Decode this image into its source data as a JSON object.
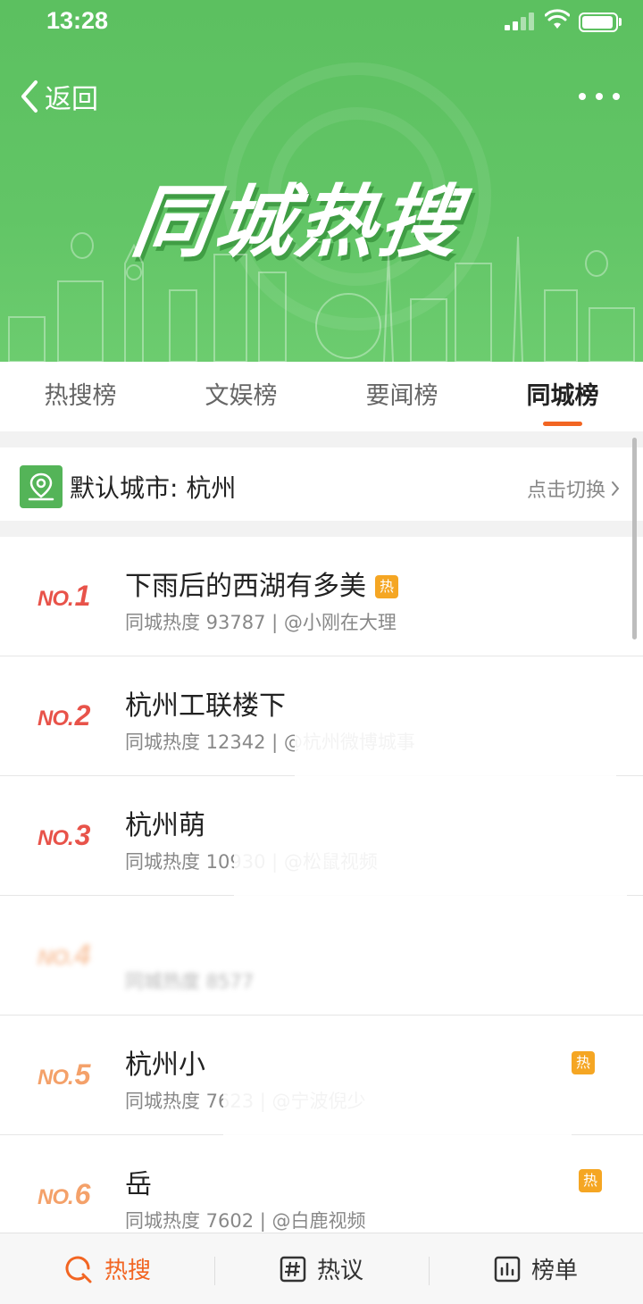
{
  "status_bar": {
    "time": "13:28"
  },
  "nav": {
    "back_label": "返回"
  },
  "banner": {
    "title": "同城热搜"
  },
  "tabs": [
    {
      "label": "热搜榜",
      "active": false
    },
    {
      "label": "文娱榜",
      "active": false
    },
    {
      "label": "要闻榜",
      "active": false
    },
    {
      "label": "同城榜",
      "active": true
    }
  ],
  "city": {
    "label": "默认城市: 杭州",
    "switch_label": "点击切换"
  },
  "items": [
    {
      "no": "NO.",
      "rank": "1",
      "title": "下雨后的西湖有多美",
      "badge": "热",
      "meta": "同城热度 93787 | @小刚在大理"
    },
    {
      "no": "NO.",
      "rank": "2",
      "title": "杭州工联楼下",
      "badge": "",
      "meta": "同城热度 12342 | @杭州微博城事"
    },
    {
      "no": "NO.",
      "rank": "3",
      "title": "杭州萌",
      "badge": "",
      "meta": "同城热度 10930 | @松鼠视频"
    },
    {
      "no": "NO.",
      "rank": "4",
      "title": "",
      "badge": "",
      "meta": "同城热度 8577"
    },
    {
      "no": "NO.",
      "rank": "5",
      "title": "杭州小",
      "badge": "热",
      "meta": "同城热度 7623 | @宁波倪少"
    },
    {
      "no": "NO.",
      "rank": "6",
      "title": "岳",
      "badge": "热",
      "meta": "同城热度 7602 | @白鹿视频"
    }
  ],
  "bottom_tabs": [
    {
      "label": "热搜",
      "icon": "search-icon",
      "active": true
    },
    {
      "label": "热议",
      "icon": "hashtag-icon",
      "active": false
    },
    {
      "label": "榜单",
      "icon": "chart-icon",
      "active": false
    }
  ],
  "colors": {
    "header_green": "#5cc060",
    "accent": "#f26522",
    "rank_hot": "#e8534a",
    "rank_warm": "#f4a16a",
    "badge": "#f5a623"
  }
}
